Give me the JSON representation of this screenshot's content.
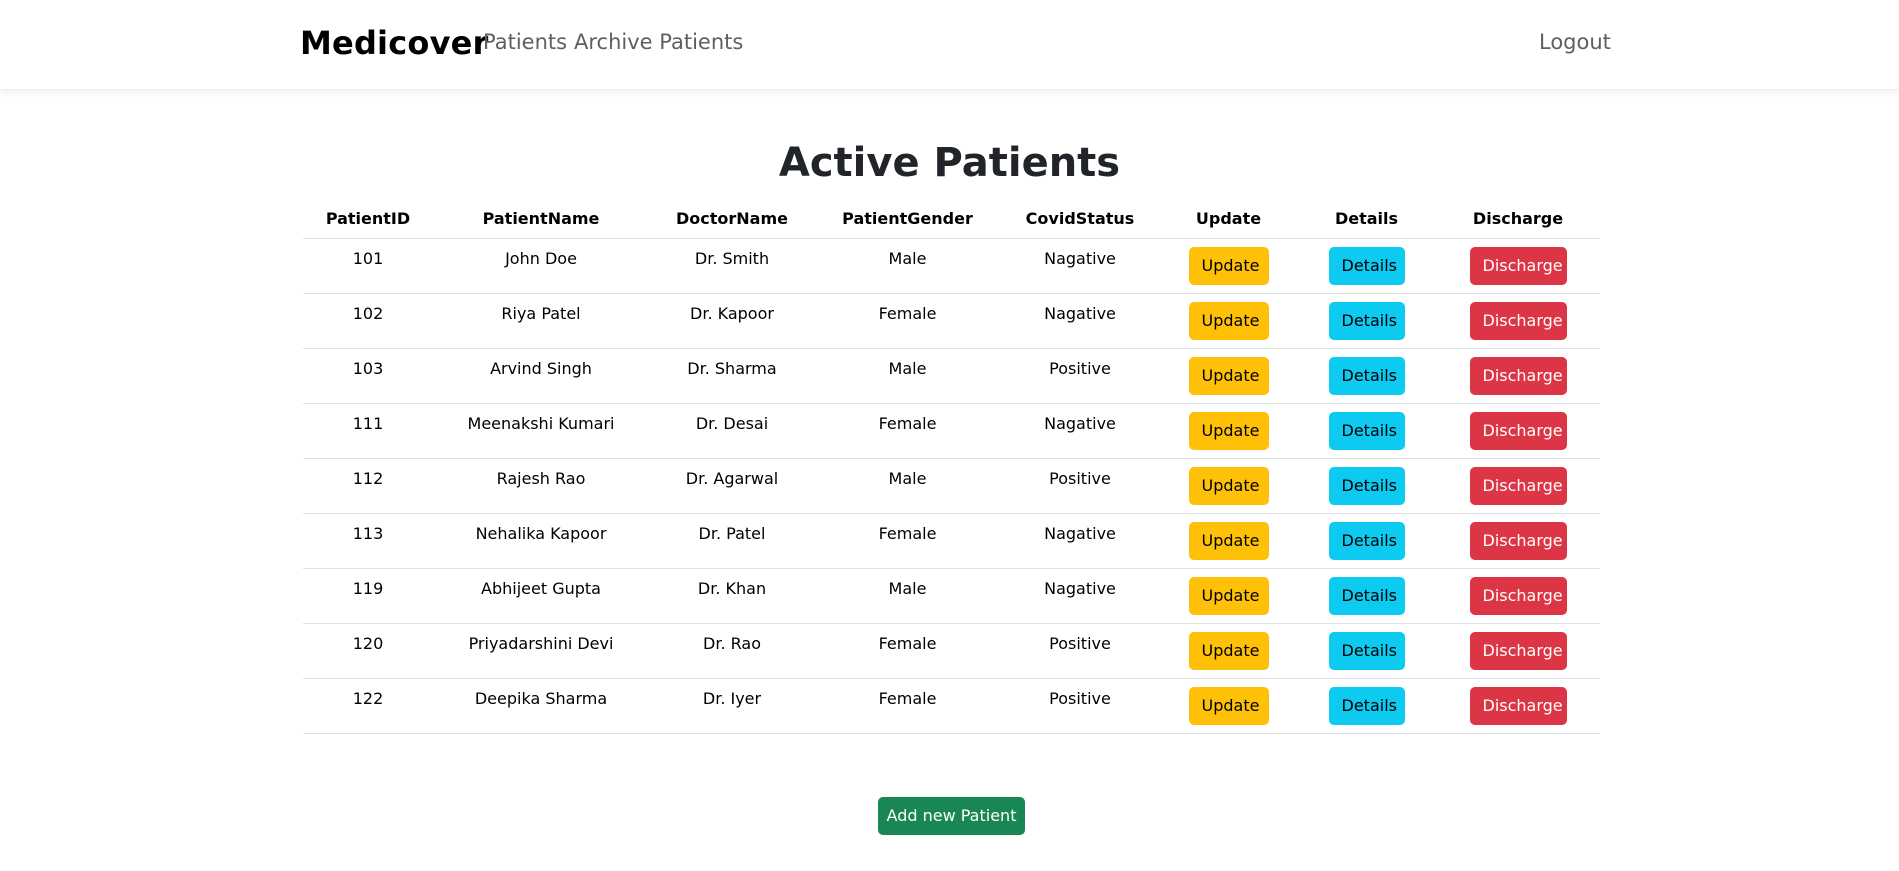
{
  "nav": {
    "brand": "Medicover",
    "links": [
      "Patients",
      "Archive Patients"
    ],
    "logout": "Logout"
  },
  "main": {
    "title": "Active Patients",
    "columns": [
      "PatientID",
      "PatientName",
      "DoctorName",
      "PatientGender",
      "CovidStatus",
      "Update",
      "Details",
      "Discharge"
    ],
    "rows": [
      {
        "id": "101",
        "name": "John Doe",
        "doctor": "Dr. Smith",
        "gender": "Male",
        "covid": "Nagative"
      },
      {
        "id": "102",
        "name": "Riya Patel",
        "doctor": "Dr. Kapoor",
        "gender": "Female",
        "covid": "Nagative"
      },
      {
        "id": "103",
        "name": "Arvind Singh",
        "doctor": "Dr. Sharma",
        "gender": "Male",
        "covid": "Positive"
      },
      {
        "id": "111",
        "name": "Meenakshi Kumari",
        "doctor": "Dr. Desai",
        "gender": "Female",
        "covid": "Nagative"
      },
      {
        "id": "112",
        "name": "Rajesh Rao",
        "doctor": "Dr. Agarwal",
        "gender": "Male",
        "covid": "Positive"
      },
      {
        "id": "113",
        "name": "Nehalika Kapoor",
        "doctor": "Dr. Patel",
        "gender": "Female",
        "covid": "Nagative"
      },
      {
        "id": "119",
        "name": "Abhijeet Gupta",
        "doctor": "Dr. Khan",
        "gender": "Male",
        "covid": "Nagative"
      },
      {
        "id": "120",
        "name": "Priyadarshini Devi",
        "doctor": "Dr. Rao",
        "gender": "Female",
        "covid": "Positive"
      },
      {
        "id": "122",
        "name": "Deepika Sharma",
        "doctor": "Dr. Iyer",
        "gender": "Female",
        "covid": "Positive"
      }
    ],
    "buttons": {
      "update": "Update",
      "details": "Details",
      "discharge": "Discharge"
    },
    "add_button": "Add new Patient"
  },
  "colors": {
    "update": "#ffc107",
    "details": "#0dcaf0",
    "discharge": "#dc3545",
    "add": "#198754"
  }
}
